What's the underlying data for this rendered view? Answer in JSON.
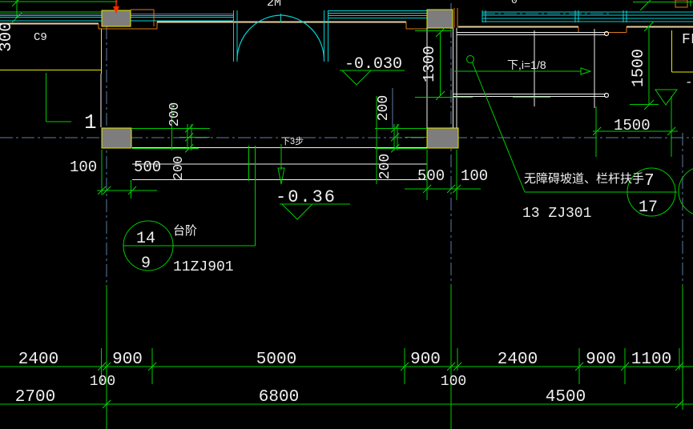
{
  "colors": {
    "background": "#000000",
    "dim_green": "#00cc00",
    "entity_white": "#f0f0f0",
    "window_cyan": "#00d4d4",
    "grid_slate": "#5b7ba6",
    "wall_tan": "#e6cfa1",
    "wall_orange": "#e07818",
    "wall_yellow": "#e8e800",
    "column_gray": "#7d7d7d",
    "marker_red": "#ff2a00"
  },
  "texts": {
    "window_tag": "C9",
    "door_tag_partial": "2M",
    "top_tag_partial": "0",
    "grid_label_1": "1",
    "level_entry": "-0.030",
    "level_ground": "-0.36",
    "stair_direction_note": "下3步",
    "ramp_slope_note": "下,i=1/8",
    "ramp_leader_note": "无障碍坡道、栏杆扶手",
    "ramp_detail_code": "13 ZJ301",
    "stair_callout_label": "台阶",
    "stair_detail_code": "11ZJ901",
    "edge_tag_partial": "FL",
    "edge_level_partial": "-"
  },
  "callout_bubbles": {
    "stair": {
      "top": "14",
      "bottom": "9"
    },
    "ramp": {
      "top": "7",
      "bottom": "17"
    }
  },
  "dimensions": {
    "left_edge_vertical": "300",
    "ramp_width_left": "1300",
    "ramp_width_right": "1500",
    "ramp_length": "1500",
    "stair_left_offset": "100",
    "stair_left_width": "500",
    "stair_right_width": "500",
    "stair_right_offset": "100",
    "riser_left_upper": "200",
    "riser_left_lower": "200",
    "riser_right_upper": "200",
    "riser_right_lower": "200",
    "row1": [
      "2400",
      "900",
      "5000",
      "900",
      "2400",
      "900",
      "1100"
    ],
    "row1_offset_left": "100",
    "row1_offset_right": "100",
    "row2": [
      "2700",
      "6800",
      "4500"
    ]
  }
}
